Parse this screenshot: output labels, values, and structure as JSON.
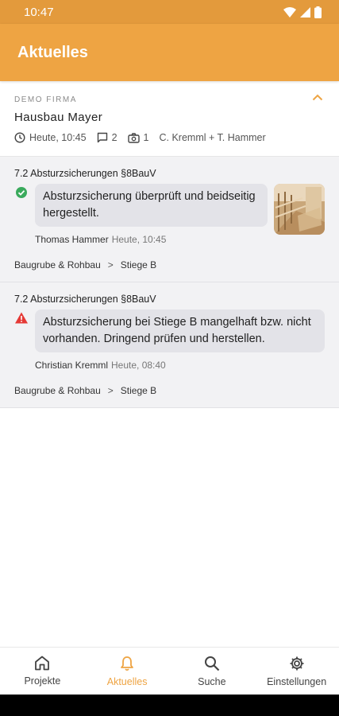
{
  "status_bar": {
    "time": "10:47"
  },
  "app_bar": {
    "title": "Aktuelles"
  },
  "project": {
    "company": "DEMO FIRMA",
    "name": "Hausbau Mayer",
    "meta": {
      "updated": "Heute, 10:45",
      "comments": "2",
      "photos": "1",
      "people": "C. Kremml + T. Hammer"
    }
  },
  "feed": {
    "items": [
      {
        "heading": "7.2 Absturzsicherungen §8BauV",
        "status": "check-circle-icon",
        "status_color": "#3aaa5c",
        "message": "Absturzsicherung überprüft und beidseitig hergestellt.",
        "author": "Thomas Hammer",
        "time": "Heute, 10:45",
        "crumb_1": "Baugrube & Rohbau",
        "crumb_2": "Stiege B"
      },
      {
        "heading": "7.2 Absturzsicherungen §8BauV",
        "status": "warning-icon",
        "status_color": "#e53935",
        "message": "Absturzsicherung bei Stiege B mangelhaft bzw. nicht vorhanden. Dringend prüfen und herstellen.",
        "author": "Christian Kremml",
        "time": "Heute, 08:40",
        "crumb_1": "Baugrube & Rohbau",
        "crumb_2": "Stiege B"
      }
    ]
  },
  "bottom_nav": {
    "projekte": "Projekte",
    "aktuelles": "Aktuelles",
    "suche": "Suche",
    "einstellungen": "Einstellungen"
  },
  "colors": {
    "accent": "#eea443",
    "status_bar": "#e39a3c"
  }
}
